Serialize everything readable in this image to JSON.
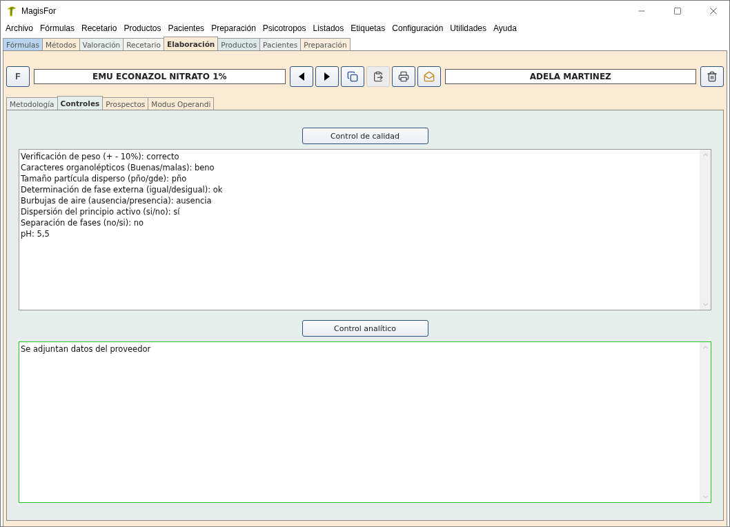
{
  "window": {
    "title": "MagisFor"
  },
  "menu": [
    "Archivo",
    "Fórmulas",
    "Recetario",
    "Productos",
    "Pacientes",
    "Preparación",
    "Psicotropos",
    "Listados",
    "Etiquetas",
    "Configuración",
    "Utilidades",
    "Ayuda"
  ],
  "tabs": [
    {
      "label": "Fórmulas",
      "selected": false,
      "color": "#b9d4ee"
    },
    {
      "label": "Métodos",
      "selected": false,
      "color": "#fbebd5"
    },
    {
      "label": "Valoración",
      "selected": false,
      "color": "#e8efec"
    },
    {
      "label": "Recetario",
      "selected": false,
      "color": "#f2f2f0"
    },
    {
      "label": "Elaboración",
      "selected": true,
      "color": "#fbebd5"
    },
    {
      "label": "Productos",
      "selected": false,
      "color": "#dde9e8"
    },
    {
      "label": "Pacientes",
      "selected": false,
      "color": "#eef0f0"
    },
    {
      "label": "Preparación",
      "selected": false,
      "color": "#f8eedb"
    }
  ],
  "toolbar": {
    "f_button": "F",
    "formula": "EMU ECONAZOL NITRATO 1%",
    "patient": "ADELA MARTINEZ"
  },
  "subtabs": [
    {
      "label": "Metodología",
      "selected": false,
      "color": "#e8efec"
    },
    {
      "label": "Controles",
      "selected": true,
      "color": "#e6eeec"
    },
    {
      "label": "Prospectos",
      "selected": false,
      "color": "#fbebd5"
    },
    {
      "label": "Modus Operandi",
      "selected": false,
      "color": "#fbebd5"
    }
  ],
  "sections": [
    {
      "button": "Control de calidad",
      "focused": false,
      "lines": [
        "Verificación de peso (+ - 10%): correcto",
        "Caracteres organolépticos (Buenas/malas): beno",
        "Tamaño partícula disperso (pño/gde): pño",
        "Determinación de fase externa (igual/desigual): ok",
        "Burbujas de aire (ausencia/presencia): ausencia",
        "Dispersión del principio activo (si/no): sí",
        "Separación de fases (no/si): no",
        "pH: 5,5"
      ]
    },
    {
      "button": "Control analítico",
      "focused": true,
      "lines": [
        "Se adjuntan datos del proveedor"
      ]
    }
  ]
}
